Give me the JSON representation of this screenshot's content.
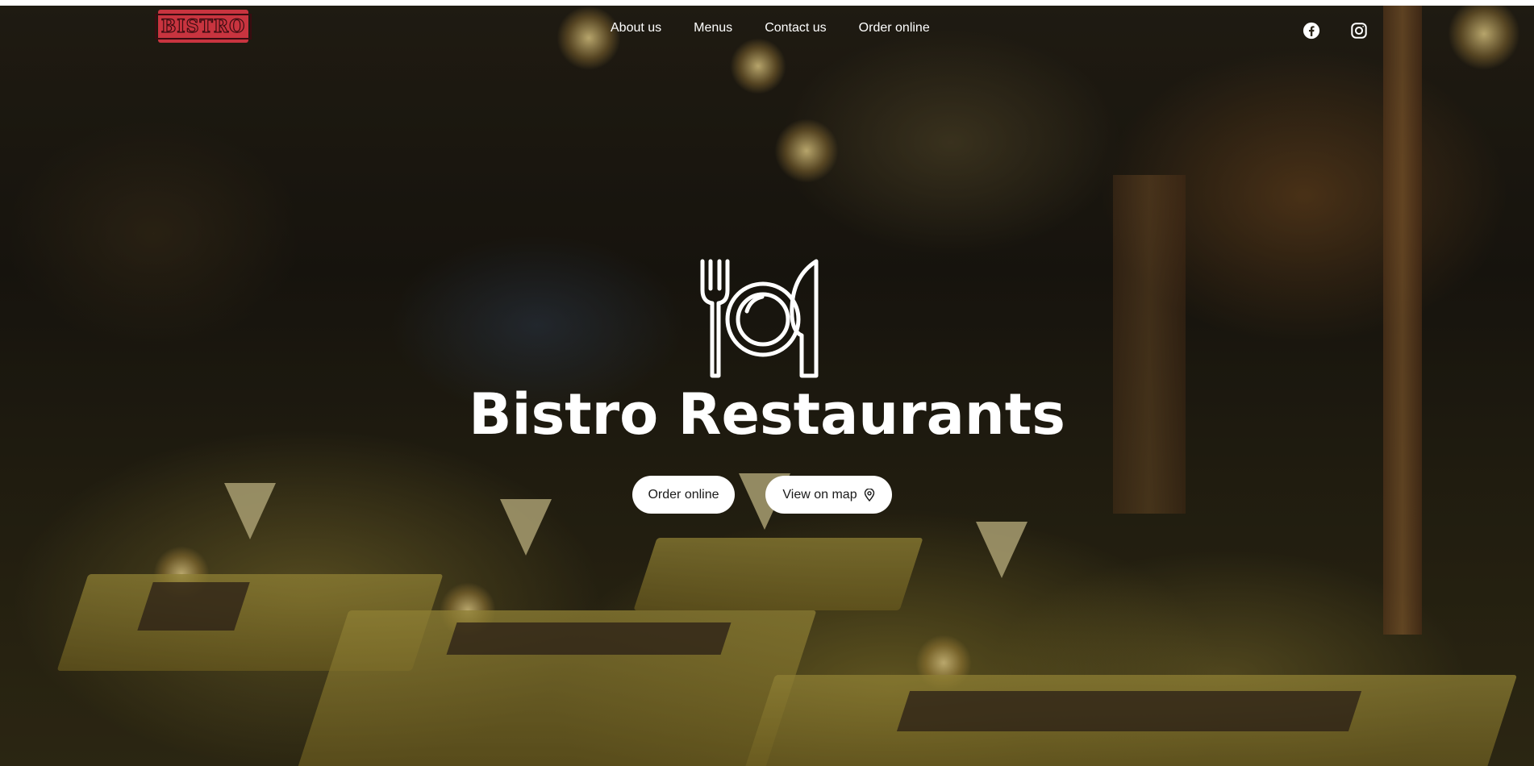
{
  "brand": {
    "logo_text": "BISTRO",
    "logo_color": "#c8343f"
  },
  "nav": {
    "items": [
      {
        "label": "About us"
      },
      {
        "label": "Menus"
      },
      {
        "label": "Contact us"
      },
      {
        "label": "Order online"
      }
    ]
  },
  "social": {
    "icons": [
      "facebook-icon",
      "instagram-icon"
    ]
  },
  "hero": {
    "icon": "plate-fork-knife-icon",
    "title": "Bistro Restaurants",
    "buttons": {
      "order_label": "Order online",
      "map_label": "View on map",
      "map_icon": "map-pin-icon"
    }
  }
}
